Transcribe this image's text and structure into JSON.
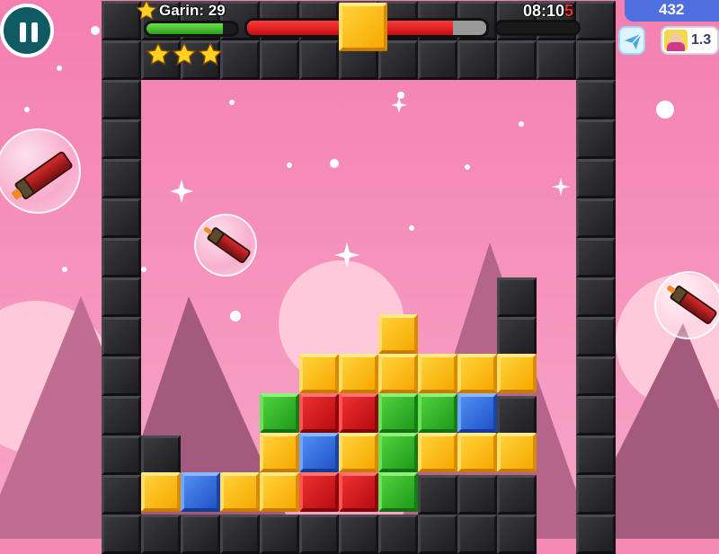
{
  "hud": {
    "player_label": "Garin: 29",
    "timer_main": "08:10",
    "timer_accent": "5",
    "stars_earned": 3,
    "stars_total": 3,
    "player_progress": 0.85,
    "drop_progress": 0.86
  },
  "right_panel": {
    "score": "432",
    "multiplier": "1.3"
  },
  "icons": {
    "pause": "pause-icon",
    "player_star": "star-icon",
    "rating_star": "star-icon",
    "send": "paper-plane-icon",
    "avatar": "avatar-icon",
    "powerup": "rocket-capsule-icon"
  },
  "colors": {
    "yellow": "#f7b500",
    "green": "#2fb327",
    "red": "#d01a1f",
    "blue": "#3366dd",
    "accent_timer": "#e8322b",
    "background": "#f48bb4"
  },
  "board": {
    "cols": 10,
    "rows": 11,
    "placed_blocks": [
      {
        "col": 6,
        "row": 6,
        "color": "yellow"
      },
      {
        "col": 4,
        "row": 7,
        "color": "yellow"
      },
      {
        "col": 5,
        "row": 7,
        "color": "yellow"
      },
      {
        "col": 6,
        "row": 7,
        "color": "yellow"
      },
      {
        "col": 7,
        "row": 7,
        "color": "yellow"
      },
      {
        "col": 8,
        "row": 7,
        "color": "yellow"
      },
      {
        "col": 9,
        "row": 7,
        "color": "yellow"
      },
      {
        "col": 3,
        "row": 8,
        "color": "green"
      },
      {
        "col": 4,
        "row": 8,
        "color": "red"
      },
      {
        "col": 5,
        "row": 8,
        "color": "red"
      },
      {
        "col": 6,
        "row": 8,
        "color": "green"
      },
      {
        "col": 7,
        "row": 8,
        "color": "green"
      },
      {
        "col": 8,
        "row": 8,
        "color": "blue"
      },
      {
        "col": 3,
        "row": 9,
        "color": "yellow"
      },
      {
        "col": 4,
        "row": 9,
        "color": "blue"
      },
      {
        "col": 5,
        "row": 9,
        "color": "yellow"
      },
      {
        "col": 6,
        "row": 9,
        "color": "green"
      },
      {
        "col": 7,
        "row": 9,
        "color": "yellow"
      },
      {
        "col": 8,
        "row": 9,
        "color": "yellow"
      },
      {
        "col": 9,
        "row": 9,
        "color": "yellow"
      },
      {
        "col": 0,
        "row": 10,
        "color": "yellow"
      },
      {
        "col": 1,
        "row": 10,
        "color": "blue"
      },
      {
        "col": 2,
        "row": 10,
        "color": "yellow"
      },
      {
        "col": 3,
        "row": 10,
        "color": "yellow"
      },
      {
        "col": 4,
        "row": 10,
        "color": "red"
      },
      {
        "col": 5,
        "row": 10,
        "color": "red"
      },
      {
        "col": 6,
        "row": 10,
        "color": "green"
      }
    ],
    "falling_block": {
      "color": "yellow"
    }
  }
}
